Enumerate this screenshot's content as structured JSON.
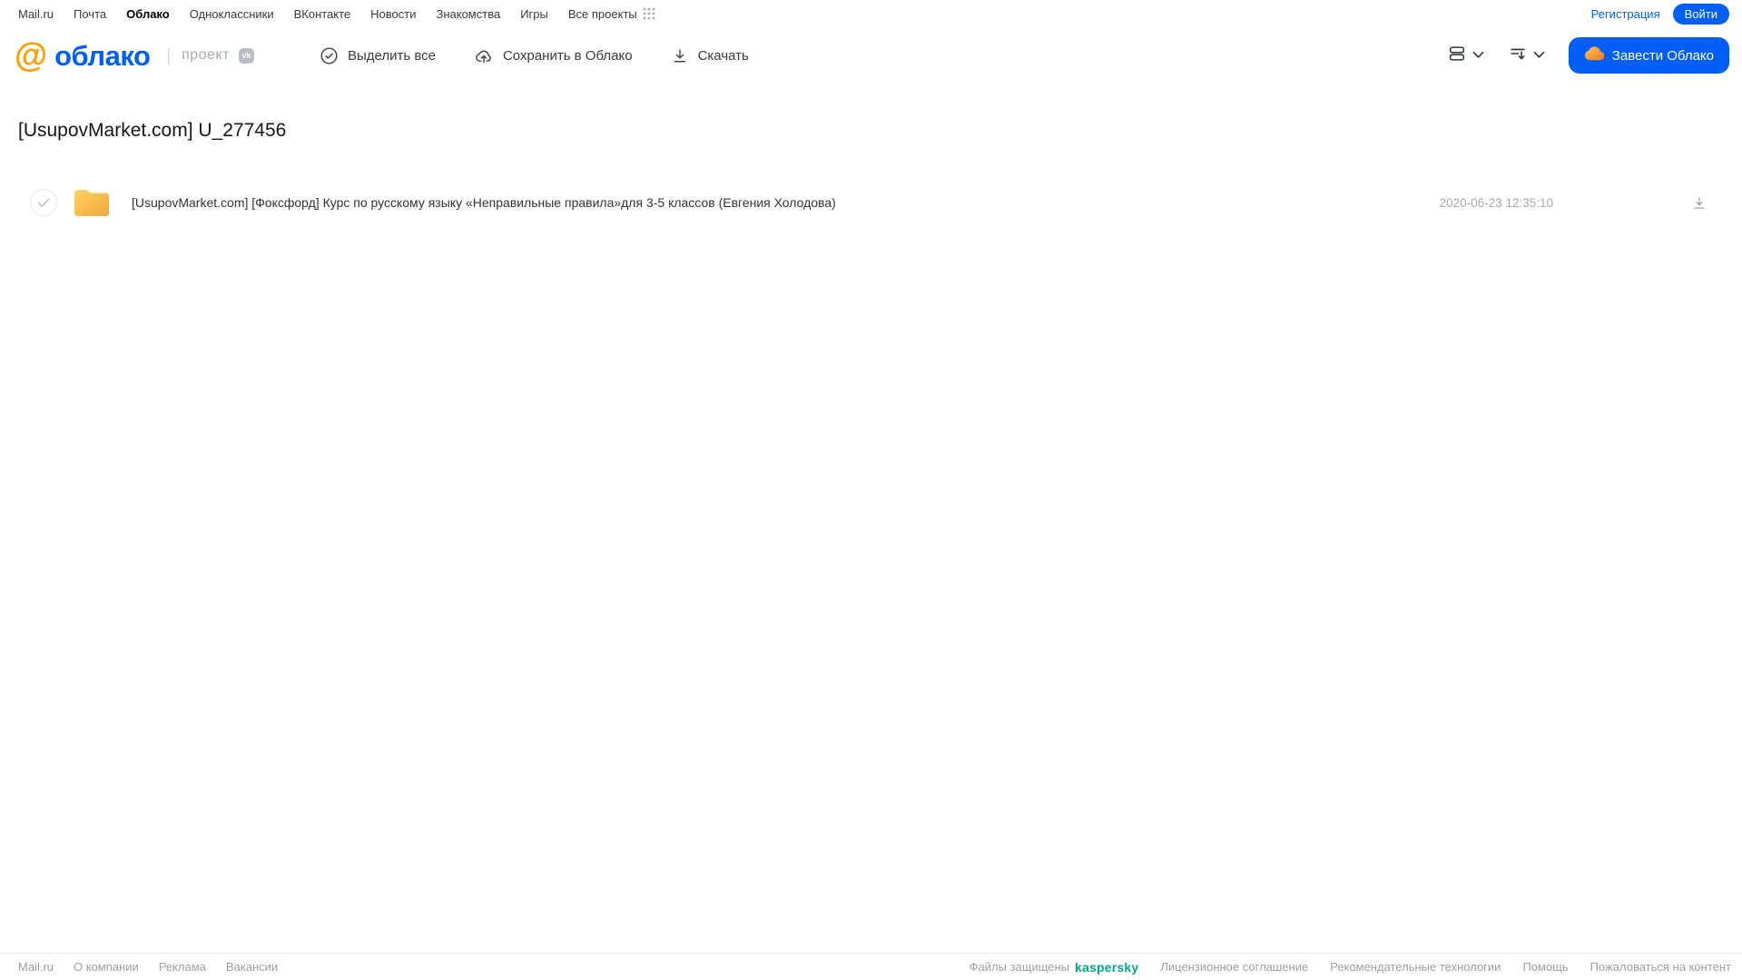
{
  "topbar": {
    "links": [
      {
        "label": "Mail.ru",
        "active": false
      },
      {
        "label": "Почта",
        "active": false
      },
      {
        "label": "Облако",
        "active": true
      },
      {
        "label": "Одноклассники",
        "active": false
      },
      {
        "label": "ВКонтакте",
        "active": false
      },
      {
        "label": "Новости",
        "active": false
      },
      {
        "label": "Знакомства",
        "active": false
      },
      {
        "label": "Игры",
        "active": false
      },
      {
        "label": "Все проекты",
        "active": false
      }
    ],
    "register_label": "Регистрация",
    "login_label": "Войти"
  },
  "header": {
    "logo_at": "@",
    "logo_text": "облако",
    "project_label": "проект",
    "vk_badge": "vk",
    "toolbar": {
      "select_all_label": "Выделить все",
      "save_to_cloud_label": "Сохранить в Облако",
      "download_label": "Скачать"
    },
    "cta_label": "Завести Облако"
  },
  "main": {
    "title": "[UsupovMarket.com] U_277456",
    "files": [
      {
        "name": "[UsupovMarket.com] [Фоксфорд] Курс по русскому языку «Неправильные правила»для 3-5 классов (Евгения Холодова)",
        "date": "2020-06-23 12:35:10"
      }
    ]
  },
  "footer": {
    "left_links": [
      "Mail.ru",
      "О компании",
      "Реклама",
      "Вакансии"
    ],
    "protected_text": "Файлы защищены",
    "kaspersky_label": "kaspersky",
    "right_links": [
      "Лицензионное соглашение",
      "Рекомендательные технологии",
      "Помощь",
      "Пожаловаться на контент"
    ]
  },
  "colors": {
    "accent_blue": "#005ff9",
    "logo_orange": "#ff9e00",
    "kaspersky_teal": "#00a88e",
    "folder_yellow_top": "#ffd45f",
    "folder_yellow_bottom": "#f2a63b"
  }
}
